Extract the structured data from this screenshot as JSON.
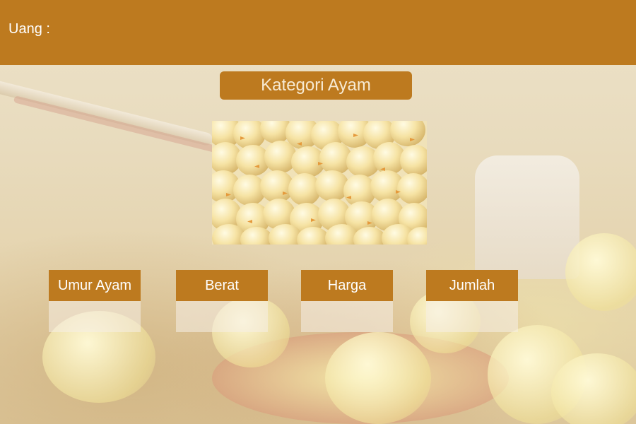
{
  "header": {
    "money_label": "Uang :"
  },
  "main": {
    "title": "Kategori Ayam",
    "image_alt": "chicks-photo",
    "stats": [
      {
        "label": "Umur Ayam",
        "value": ""
      },
      {
        "label": "Berat",
        "value": ""
      },
      {
        "label": "Harga",
        "value": ""
      },
      {
        "label": "Jumlah",
        "value": ""
      }
    ]
  },
  "colors": {
    "accent": "#bd7a1f",
    "header_text": "#ffffff",
    "title_text": "#f7ead3"
  }
}
